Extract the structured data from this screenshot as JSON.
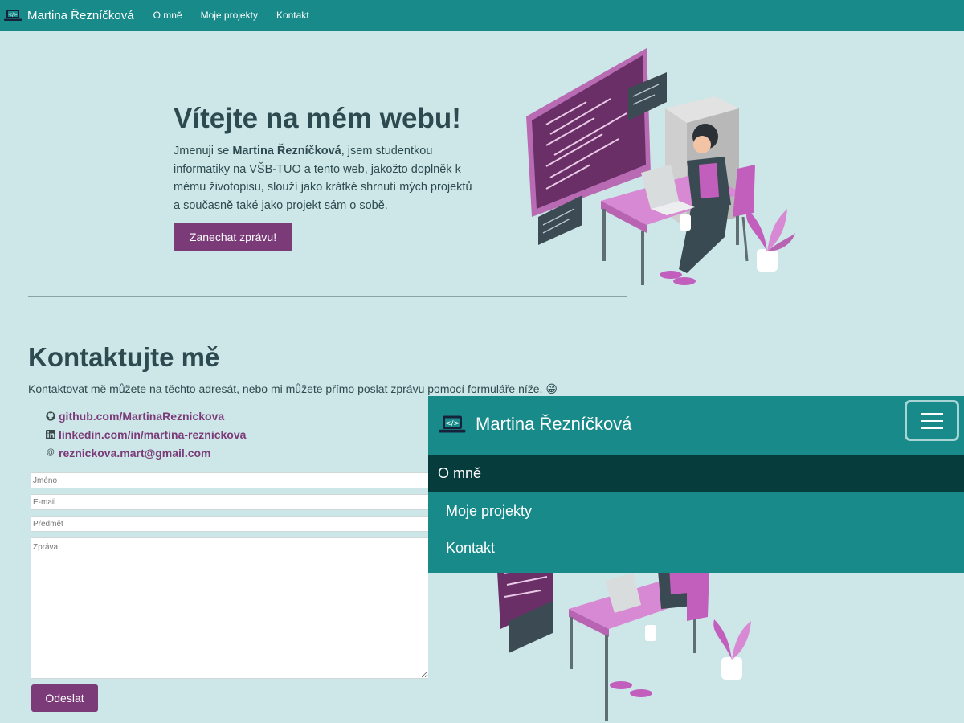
{
  "navbar": {
    "brand": "Martina Řezníčková",
    "links": [
      "O mně",
      "Moje projekty",
      "Kontakt"
    ]
  },
  "hero": {
    "title": "Vítejte na mém webu!",
    "text_before": "Jmenuji se ",
    "text_name": "Martina Řezníčková",
    "text_after": ", jsem studentkou informatiky na VŠB-TUO a tento web, jakožto doplněk k mému životopisu, slouží jako krátké shrnutí mých projektů a současně také jako projekt sám o sobě.",
    "button": "Zanechat zprávu!"
  },
  "contact": {
    "title": "Kontaktujte mě",
    "intro": "Kontaktovat mě můžete na těchto adresát, nebo mi můžete přímo poslat zprávu pomocí formuláře níže. 😁",
    "links": [
      {
        "icon": "github-icon",
        "text": "github.com/MartinaReznickova"
      },
      {
        "icon": "linkedin-icon",
        "text": "linkedin.com/in/martina-reznickova"
      },
      {
        "icon": "at-icon",
        "text": "reznickova.mart@gmail.com"
      }
    ],
    "form": {
      "name_placeholder": "Jméno",
      "email_placeholder": "E-mail",
      "subject_placeholder": "Předmět",
      "message_placeholder": "Zpráva",
      "submit": "Odeslat"
    }
  },
  "mobile_menu": {
    "brand": "Martina Řezníčková",
    "items": [
      "O mně",
      "Moje projekty",
      "Kontakt"
    ]
  },
  "colors": {
    "navbar": "#188a8a",
    "background": "#cde7e8",
    "accent_purple": "#7b3a78",
    "active_menu": "#073c3d"
  }
}
